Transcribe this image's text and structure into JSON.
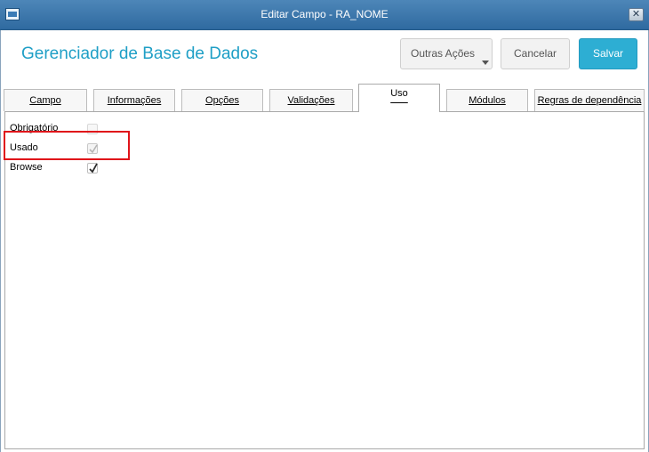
{
  "window": {
    "title": "Editar Campo - RA_NOME",
    "close_glyph": "✕"
  },
  "header": {
    "app_title": "Gerenciador de Base de Dados",
    "buttons": {
      "outras_acoes": "Outras Ações",
      "cancelar": "Cancelar",
      "salvar": "Salvar"
    }
  },
  "tabs": [
    {
      "label": "Campo",
      "active": false
    },
    {
      "label": "Informações",
      "active": false
    },
    {
      "label": "Opções",
      "active": false
    },
    {
      "label": "Validações",
      "active": false
    },
    {
      "label": "Uso",
      "active": true
    },
    {
      "label": "Módulos",
      "active": false
    },
    {
      "label": "Regras de dependência",
      "active": false
    }
  ],
  "uso_panel": {
    "fields": [
      {
        "label": "Obrigatório",
        "checked": false,
        "enabled": false
      },
      {
        "label": "Usado",
        "checked": true,
        "enabled": false
      },
      {
        "label": "Browse",
        "checked": true,
        "enabled": true
      }
    ]
  },
  "colors": {
    "titlebar": "#3a78ad",
    "accent": "#1f9fc6",
    "primary_button": "#2daed3",
    "highlight_box": "#e0141a"
  },
  "icons": {
    "app": "window-app-icon",
    "close": "close-icon",
    "dropdown": "chevron-down-icon",
    "check": "checkmark-icon"
  }
}
